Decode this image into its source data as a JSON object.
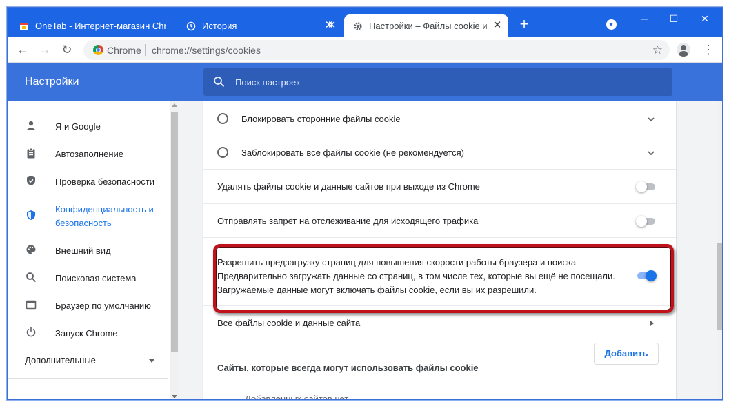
{
  "tabs": [
    {
      "title": "OneTab - Интернет-магазин Chrome",
      "close": "✕"
    },
    {
      "title": "История",
      "close": "✕"
    },
    {
      "title": "Настройки – Файлы cookie и данные сайтов",
      "close": "✕"
    }
  ],
  "newtab": "+",
  "window_controls": {
    "minimize": "─",
    "maximize": "☐",
    "close": "✕"
  },
  "toolbar": {
    "back": "←",
    "forward": "→",
    "reload": "↻",
    "site_label": "Chrome",
    "url": "chrome://settings/cookies",
    "bookmark": "☆",
    "menu": "⋮"
  },
  "header": {
    "title": "Настройки",
    "search_placeholder": "Поиск настроек"
  },
  "sidebar": {
    "items": [
      {
        "label": "Я и Google",
        "icon": "person-icon",
        "glyph": "👤"
      },
      {
        "label": "Автозаполнение",
        "icon": "clipboard-icon",
        "glyph": "📋"
      },
      {
        "label": "Проверка безопасности",
        "icon": "shield-icon",
        "glyph": "🛡"
      },
      {
        "label": "Конфиденциальность и безопасность",
        "icon": "shield-lock-icon",
        "glyph": "🛡"
      },
      {
        "label": "Внешний вид",
        "icon": "palette-icon",
        "glyph": "🎨"
      },
      {
        "label": "Поисковая система",
        "icon": "search-icon",
        "glyph": "🔍"
      },
      {
        "label": "Браузер по умолчанию",
        "icon": "browser-icon",
        "glyph": "▭"
      },
      {
        "label": "Запуск Chrome",
        "icon": "power-icon",
        "glyph": "⏻"
      }
    ],
    "advanced": "Дополнительные"
  },
  "main": {
    "block_third_party": "Блокировать сторонние файлы cookie",
    "block_all": "Заблокировать все файлы cookie (не рекомендуется)",
    "clear_on_exit": "Удалять файлы cookie и данные сайтов при выходе из Chrome",
    "do_not_track": "Отправлять запрет на отслеживание для исходящего трафика",
    "preload_title": "Разрешить предзагрузку страниц для повышения скорости работы браузера и поиска",
    "preload_desc1": "Предварительно загружать данные со страниц, в том числе тех, которые вы ещё не посещали.",
    "preload_desc2": "Загружаемые данные могут включать файлы cookie, если вы их разрешили.",
    "all_cookies": "Все файлы cookie и данные сайта",
    "always_allow": "Сайты, которые всегда могут использовать файлы cookie",
    "add_button": "Добавить",
    "no_sites": "Добавленных сайтов нет"
  },
  "toggles": {
    "clear_on_exit": false,
    "do_not_track": false,
    "preload": true
  },
  "colors": {
    "titlebar": "#1c66e6",
    "header": "#3a72db",
    "accent": "#1a73e8",
    "highlight": "#c0121b"
  }
}
